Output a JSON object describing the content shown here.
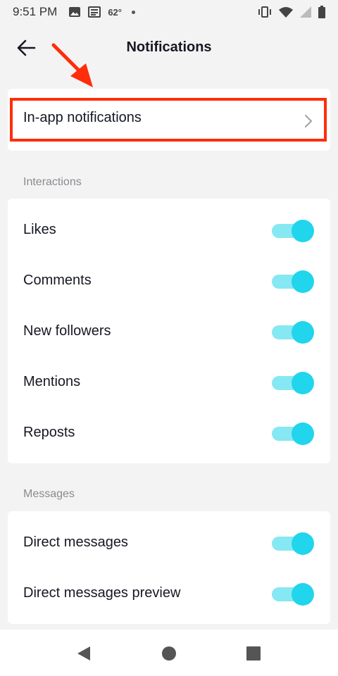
{
  "status_bar": {
    "time": "9:51 PM",
    "temperature": "62°",
    "icons_left": [
      "photo-icon",
      "news-icon",
      "temperature-icon",
      "dot-icon"
    ],
    "icons_right": [
      "vibrate-icon",
      "wifi-icon",
      "signal-icon",
      "battery-icon"
    ]
  },
  "header": {
    "title": "Notifications",
    "back_icon": "back-arrow-icon"
  },
  "in_app": {
    "label": "In-app notifications",
    "chevron_icon": "chevron-right-icon",
    "highlight_color": "#ff2d0a"
  },
  "interactions": {
    "section_label": "Interactions",
    "items": [
      {
        "label": "Likes",
        "enabled": true
      },
      {
        "label": "Comments",
        "enabled": true
      },
      {
        "label": "New followers",
        "enabled": true
      },
      {
        "label": "Mentions",
        "enabled": true
      },
      {
        "label": "Reposts",
        "enabled": true
      }
    ]
  },
  "messages": {
    "section_label": "Messages",
    "items": [
      {
        "label": "Direct messages",
        "enabled": true
      },
      {
        "label": "Direct messages preview",
        "enabled": true
      }
    ]
  },
  "nav": {
    "back_icon": "nav-back-icon",
    "home_icon": "nav-home-icon",
    "recents_icon": "nav-recents-icon"
  },
  "colors": {
    "toggle_on": "#20d5ec",
    "toggle_track": "#86e8f2",
    "annotation": "#ff2d0a"
  }
}
